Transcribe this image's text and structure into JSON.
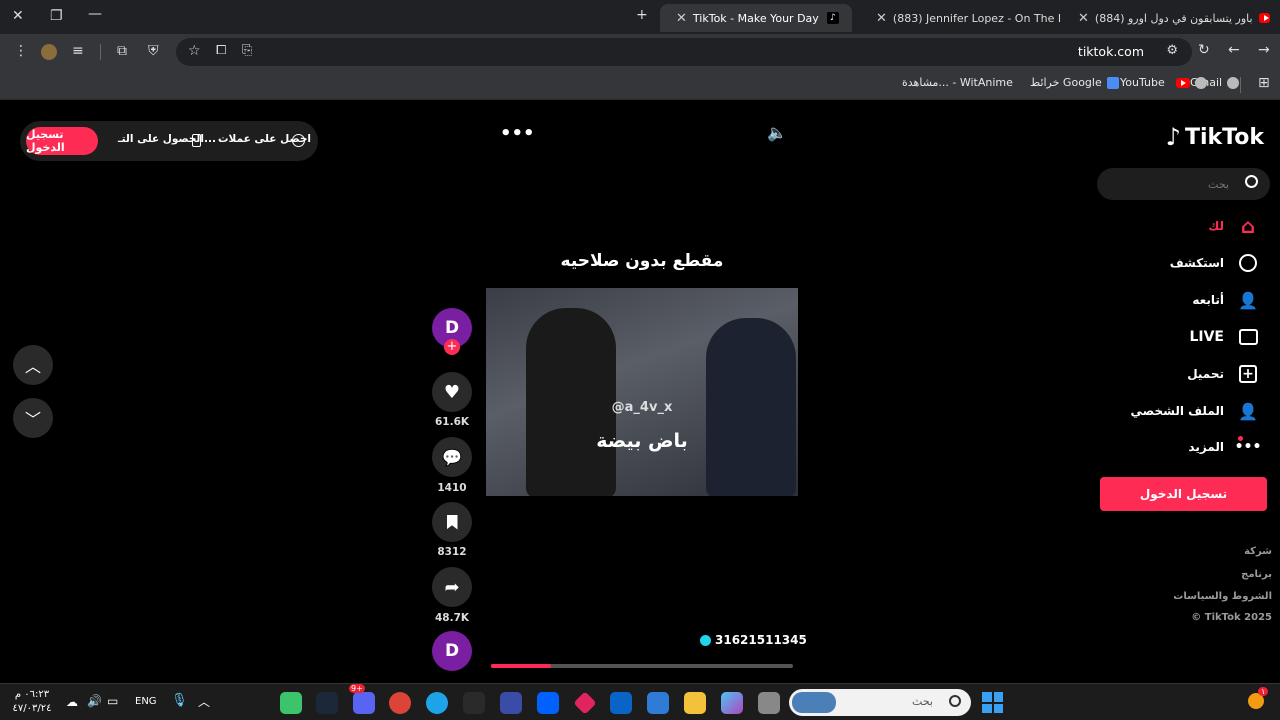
{
  "browser": {
    "tabs": [
      {
        "title": "(884) باور يتسابقون في دول اورو",
        "favicon": "youtube"
      },
      {
        "title": "(883) Jennifer Lopez - On The F",
        "favicon": "youtube"
      },
      {
        "title": "TikTok - Make Your Day",
        "favicon": "tiktok",
        "active": true
      }
    ],
    "new_tab": "+",
    "url": "tiktok.com",
    "bookmarks": [
      "Gmail",
      "YouTube",
      "خرائط Google",
      "مشاهدة... - WitAnime"
    ]
  },
  "header": {
    "login_button": "تسجيل الدخول",
    "get_app": "الحصول على التـ...",
    "get_coins": "احصل على عملات"
  },
  "logo": "TikTok",
  "search": {
    "placeholder": "بحث"
  },
  "sidebar": {
    "items": [
      {
        "label": "لك",
        "icon": "home-icon",
        "active": true
      },
      {
        "label": "استكشف",
        "icon": "compass-icon"
      },
      {
        "label": "أتابعه",
        "icon": "following-icon"
      },
      {
        "label": "LIVE",
        "icon": "live-icon"
      },
      {
        "label": "تحميل",
        "icon": "upload-icon"
      },
      {
        "label": "الملف الشخصي",
        "icon": "profile-icon"
      },
      {
        "label": "المزيد",
        "icon": "more-icon"
      }
    ],
    "login_button": "تسجيل الدخول",
    "footer": [
      "شركة",
      "برنامج",
      "الشروط والسياسات",
      "© TikTok 2025"
    ]
  },
  "video": {
    "title": "مقطع بدون صلاحيه",
    "watermark": "@a_4v_x",
    "caption": "باض بيضة",
    "author": "31621511345",
    "progress": 0.2
  },
  "actions": {
    "avatar_letter": "D",
    "likes": "61.6K",
    "comments": "1410",
    "saves": "8312",
    "shares": "48.7K"
  },
  "taskbar": {
    "search_placeholder": "بحث",
    "lang": "ENG",
    "time": "٠٦:٢٣ م",
    "date": "٤٧/٠٣/٢٤",
    "badge": "9+",
    "notif": "١"
  },
  "colors": {
    "accent": "#fe2c55",
    "bg": "#000000"
  }
}
